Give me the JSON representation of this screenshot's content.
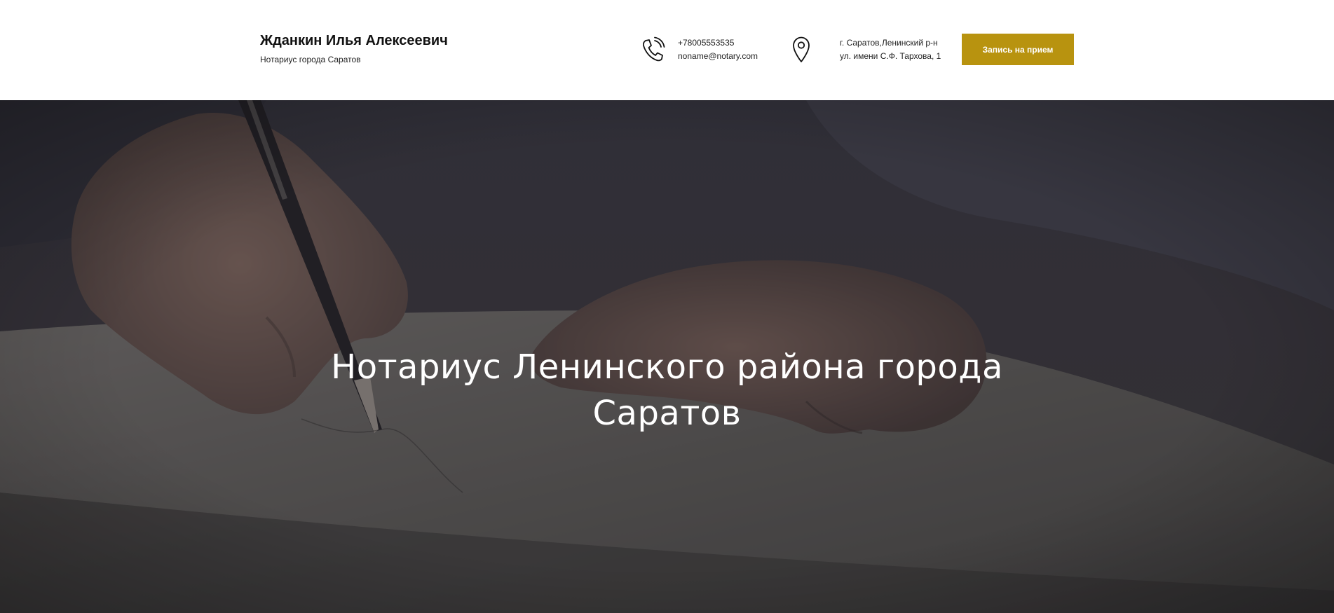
{
  "header": {
    "brand_name": "Жданкин Илья Алексеевич",
    "brand_subtitle": "Нотариус города Саратов",
    "phone": {
      "icon": "phone-icon",
      "number": "+78005553535",
      "email": "noname@notary.com"
    },
    "address": {
      "icon": "location-pin-icon",
      "line1": "г. Саратов,Ленинский р-н",
      "line2": "ул. имени С.Ф. Тархова, 1"
    },
    "cta_label": "Запись на прием"
  },
  "hero": {
    "title_line1": "Нотариус Ленинского района города",
    "title_line2": "Саратов"
  },
  "colors": {
    "accent": "#b8930f",
    "hero_overlay": "#2b2a30",
    "text_dark": "#111111"
  }
}
